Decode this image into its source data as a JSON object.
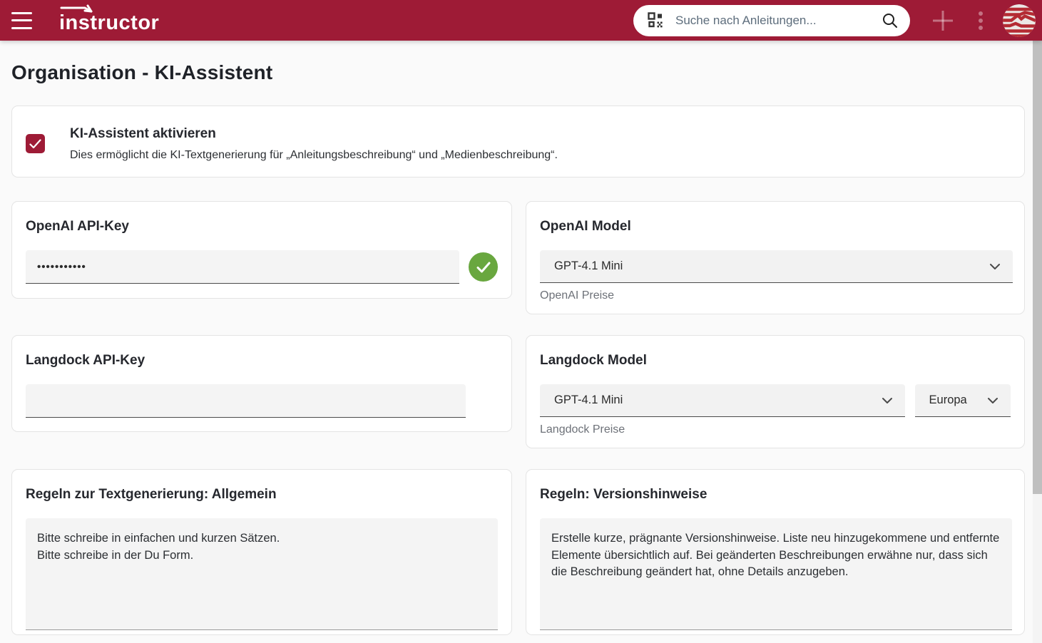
{
  "colors": {
    "brand_red": "#9E1B36",
    "success_green": "#69A73F",
    "card_border": "#e4e4e4",
    "field_bg": "#f4f4f4"
  },
  "header": {
    "logo_text": "instructor",
    "search_placeholder": "Suche nach Anleitungen..."
  },
  "page_title": "Organisation - KI-Assistent",
  "assistant_card": {
    "title": "KI-Assistent aktivieren",
    "description": "Dies ermöglicht die KI-Textgenerierung für „Anleitungsbeschreibung“ und „Medienbeschreibung“.",
    "checked": true
  },
  "openai_key_card": {
    "title": "OpenAI API-Key",
    "masked_value": "•••••••••••"
  },
  "openai_model_card": {
    "title": "OpenAI Model",
    "selected_model": "GPT-4.1 Mini",
    "price_link": "OpenAI Preise"
  },
  "langdock_key_card": {
    "title": "Langdock API-Key",
    "value": ""
  },
  "langdock_model_card": {
    "title": "Langdock Model",
    "selected_model": "GPT-4.1 Mini",
    "selected_region": "Europa",
    "price_link": "Langdock Preise"
  },
  "rules_general_card": {
    "title": "Regeln zur Textgenerierung: Allgemein",
    "value": "Bitte schreibe in einfachen und kurzen Sätzen.\nBitte schreibe in der Du Form."
  },
  "rules_version_card": {
    "title": "Regeln: Versionshinweise",
    "value": "Erstelle kurze, prägnante Versionshinweise. Liste neu hinzugekommene und entfernte Elemente übersichtlich auf. Bei geänderten Beschreibungen erwähne nur, dass sich die Beschreibung geändert hat, ohne Details anzugeben."
  }
}
